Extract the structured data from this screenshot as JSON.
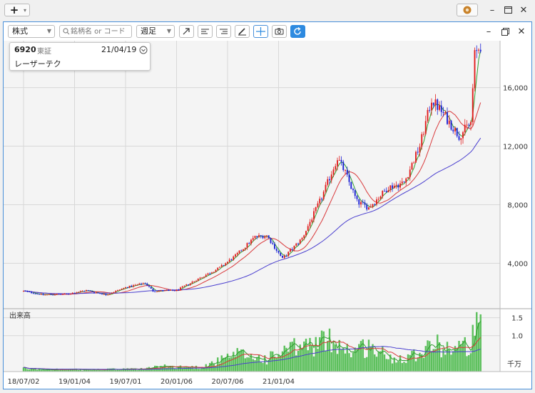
{
  "topbar": {
    "add_label": "+"
  },
  "toolbar": {
    "market_type": "株式",
    "search_placeholder": "銘柄名 or コード",
    "period": "週足"
  },
  "info": {
    "code": "6920",
    "exchange": "東証",
    "date": "21/04/19",
    "name": "レーザーテク"
  },
  "volume": {
    "label": "出来高",
    "unit": "千万"
  },
  "chart_data": {
    "type": "candlestick",
    "x_labels": [
      "18/07/02",
      "19/01/04",
      "19/07/01",
      "20/01/06",
      "20/07/06",
      "21/01/04"
    ],
    "price_axis": {
      "ticks": [
        "4,000",
        "8,000",
        "12,000",
        "16,000"
      ],
      "values": [
        4000,
        8000,
        12000,
        16000
      ],
      "range": [
        900,
        19200
      ]
    },
    "volume_axis": {
      "ticks": [
        "1.0",
        "1.5"
      ],
      "values": [
        1.0,
        1.5
      ],
      "range": [
        0,
        1.75
      ]
    },
    "close_path": [
      [
        0,
        2100
      ],
      [
        10,
        1850
      ],
      [
        22,
        1900
      ],
      [
        32,
        2150
      ],
      [
        42,
        1850
      ],
      [
        52,
        2350
      ],
      [
        62,
        2650
      ],
      [
        66,
        2100
      ],
      [
        78,
        2150
      ],
      [
        90,
        3000
      ],
      [
        100,
        3700
      ],
      [
        108,
        4500
      ],
      [
        118,
        5800
      ],
      [
        124,
        5900
      ],
      [
        132,
        4300
      ],
      [
        142,
        5700
      ],
      [
        152,
        8500
      ],
      [
        160,
        11200
      ],
      [
        164,
        10200
      ],
      [
        170,
        8200
      ],
      [
        176,
        7800
      ],
      [
        186,
        9200
      ],
      [
        194,
        9500
      ],
      [
        202,
        12000
      ],
      [
        208,
        15200
      ],
      [
        214,
        14200
      ],
      [
        222,
        12700
      ],
      [
        228,
        13600
      ],
      [
        230,
        18200
      ],
      [
        233,
        18900
      ]
    ],
    "volume_path": [
      [
        0,
        0.08
      ],
      [
        30,
        0.05
      ],
      [
        60,
        0.07
      ],
      [
        70,
        0.14
      ],
      [
        90,
        0.12
      ],
      [
        110,
        0.48
      ],
      [
        124,
        0.35
      ],
      [
        136,
        0.62
      ],
      [
        148,
        0.75
      ],
      [
        158,
        0.9
      ],
      [
        166,
        0.58
      ],
      [
        176,
        0.7
      ],
      [
        188,
        0.35
      ],
      [
        200,
        0.5
      ],
      [
        208,
        0.78
      ],
      [
        214,
        0.68
      ],
      [
        222,
        0.65
      ],
      [
        228,
        0.75
      ],
      [
        231,
        1.3
      ],
      [
        233,
        1.12
      ]
    ],
    "series": [
      {
        "color": "#2f9e2f"
      },
      {
        "color": "#d9393b"
      },
      {
        "color": "#4a3fcf"
      }
    ],
    "colors": {
      "up": "#e11d1d",
      "down": "#1d22d6",
      "volume": "#5cc05c"
    }
  }
}
